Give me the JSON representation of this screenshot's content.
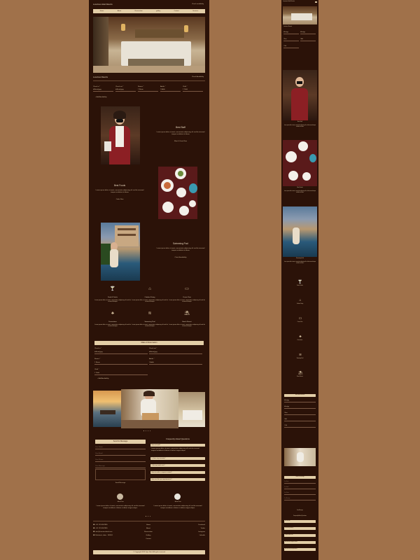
{
  "brand": "Luxurious Hotel Resorts",
  "check_label": "Check availability",
  "nav": [
    "Home",
    "About",
    "Reservation",
    "gallery",
    "Contact",
    "Services"
  ],
  "booking": {
    "title": "Luxurious Resorts",
    "check": "Check Availability",
    "fields": [
      {
        "label": "Check in *",
        "value": "dd/mm/yyyy"
      },
      {
        "label": "Check out *",
        "value": "dd/mm/yyyy"
      },
      {
        "label": "Rooms *",
        "value": "1 Room"
      },
      {
        "label": "Adults *",
        "value": "1 Adult"
      },
      {
        "label": "Child *",
        "value": "1 Child"
      }
    ],
    "more": "+ Add Availability"
  },
  "features": [
    {
      "title": "Best Staff",
      "text": "Lorem ipsum dolor sit amet, consectetur adipiscing elit sed do eiusmod tempor incididunt ut labore",
      "link": "Meet & Greet Now"
    },
    {
      "title": "Best Foods",
      "text": "Lorem ipsum dolor sit amet, consectetur adipiscing elit sed do eiusmod tempor incididunt ut labore",
      "link": "Order Now"
    },
    {
      "title": "Swimming Pool",
      "text": "Lorem ipsum dolor sit amet, consectetur adipiscing elit sed do eiusmod tempor incididunt ut labore",
      "link": "Check Availability"
    }
  ],
  "amenities": [
    {
      "title": "Food & Drinks",
      "icon": "cocktail-icon"
    },
    {
      "title": "Outdoor Dining",
      "icon": "dining-icon"
    },
    {
      "title": "Ocean View",
      "icon": "tv-icon"
    },
    {
      "title": "Decorations",
      "icon": "tree-icon"
    },
    {
      "title": "Swimming Pool",
      "icon": "pool-icon"
    },
    {
      "title": "Beach Resort",
      "icon": "beach-icon"
    }
  ],
  "amenity_text": "Lorem ipsum dolor sit amet, consectetur adipiscing elit sed do eiusmod tempor",
  "reservation": {
    "title": "Make A Reservation",
    "labels": [
      "Check in *",
      "Check out *",
      "Rooms *",
      "Adults *",
      "Child *"
    ],
    "values": [
      "dd/mm/yyyy",
      "dd/mm/yyyy",
      "1 Room",
      "1 Adult",
      "1 Child"
    ],
    "more": "+ Add Availability"
  },
  "message": {
    "title": "Send Us Message",
    "placeholders": [
      "Your Name",
      "Your Email",
      "Your Phone",
      "Your Message"
    ],
    "button": "Send Message"
  },
  "faq": {
    "title": "Frequently Asked Questions",
    "items": [
      "How to book?",
      "Is there any amenity?",
      "Child and adult rule?",
      "How to make a request visited?",
      "How are the spa requirements?"
    ],
    "answer": "Lorem ipsum dolor sit amet, consectetur adipiscing elit sed do eiusmod tempor incididunt ut labore et dolore magna aliqua."
  },
  "testimonials": [
    {
      "name": "John Doe",
      "text": "Lorem ipsum dolor sit amet, consectetur adipiscing elit sed do eiusmod tempor incididunt ut labore et dolore magna aliqua."
    },
    {
      "name": "John Doe",
      "text": "Lorem ipsum dolor sit amet, consectetur adipiscing elit sed do eiusmod tempor incididunt ut labore et dolore magna aliqua."
    }
  ],
  "footer": {
    "contacts": [
      "+91 123 4567890",
      "+91 123 4567890",
      "info@luxurioushotel.com",
      "Rishikesh, India - 249201"
    ],
    "links": [
      "Home",
      "About",
      "Reservation",
      "Gallery",
      "Contact"
    ],
    "social": [
      "Facebook",
      "Twitter",
      "Instagram",
      "LinkedIn"
    ],
    "copyright": "© Copyright 2023 Dipa Dahl. All rights reserved"
  },
  "colors": {
    "page": "#a0714a",
    "panel": "#2b1208",
    "accent": "#e3cea7"
  }
}
